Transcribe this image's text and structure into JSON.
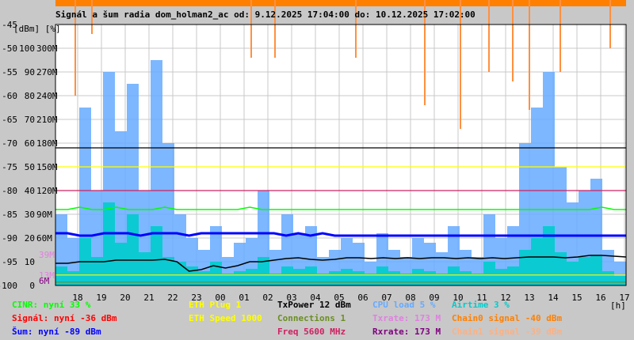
{
  "chart_data": {
    "type": "line",
    "title": "Signál a šum radia dom_holman2_ac od: 9.12.2025 17:04:00 do: 10.12.2025 17:02:00",
    "ylabel": "[dBm] [%]",
    "xlabel": "[h]",
    "ylim": [
      -100,
      -45
    ],
    "y_ticks": [
      {
        "dbm": "-45",
        "pct": "",
        "rate": ""
      },
      {
        "dbm": "-50",
        "pct": "100",
        "rate": "300M"
      },
      {
        "dbm": "-55",
        "pct": "90",
        "rate": "270M"
      },
      {
        "dbm": "-60",
        "pct": "80",
        "rate": "240M"
      },
      {
        "dbm": "-65",
        "pct": "70",
        "rate": "210M"
      },
      {
        "dbm": "-70",
        "pct": "60",
        "rate": "180M"
      },
      {
        "dbm": "-75",
        "pct": "50",
        "rate": "150M"
      },
      {
        "dbm": "-80",
        "pct": "40",
        "rate": "120M"
      },
      {
        "dbm": "-85",
        "pct": "30",
        "rate": "90M"
      },
      {
        "dbm": "-90",
        "pct": "20",
        "rate": "60M"
      },
      {
        "dbm": "-95",
        "pct": "10",
        "rate": ""
      },
      {
        "dbm": "-100",
        "pct": "0",
        "rate": ""
      }
    ],
    "x_ticks": [
      "18",
      "19",
      "20",
      "21",
      "22",
      "23",
      "00",
      "01",
      "02",
      "03",
      "04",
      "05",
      "06",
      "07",
      "08",
      "09",
      "10",
      "11",
      "12",
      "13",
      "14",
      "15",
      "16",
      "17"
    ],
    "rate_markers": [
      {
        "label": "39M",
        "value": 39,
        "color": "#e080e0"
      },
      {
        "label": "13M",
        "value": 13,
        "color": "#e080e0"
      },
      {
        "label": "6M",
        "value": 6,
        "color": "#800080"
      }
    ],
    "hlines": [
      {
        "name": "txpower",
        "dbm": -71,
        "color": "#000000"
      },
      {
        "name": "eth-speed",
        "dbm": -75,
        "color": "#ffff00"
      },
      {
        "name": "freq",
        "dbm": -80,
        "color": "#d02060"
      },
      {
        "name": "eth-plug",
        "dbm": -97.8,
        "color": "#ffff00"
      },
      {
        "name": "connections",
        "dbm": -99.3,
        "color": "#6b8e23"
      }
    ],
    "series": [
      {
        "name": "CPU load",
        "unit": "%",
        "color": "#66aaff",
        "values": [
          30,
          20,
          75,
          40,
          90,
          65,
          85,
          40,
          95,
          60,
          30,
          20,
          15,
          25,
          12,
          18,
          20,
          40,
          15,
          30,
          22,
          25,
          12,
          15,
          20,
          18,
          10,
          22,
          15,
          12,
          20,
          18,
          14,
          25,
          15,
          12,
          30,
          20,
          25,
          60,
          75,
          90,
          50,
          35,
          40,
          45,
          15,
          10
        ]
      },
      {
        "name": "Airtime",
        "unit": "%",
        "color": "#00cccc",
        "values": [
          8,
          6,
          20,
          12,
          35,
          18,
          30,
          14,
          25,
          12,
          10,
          8,
          6,
          10,
          5,
          6,
          7,
          12,
          5,
          8,
          7,
          8,
          5,
          6,
          7,
          6,
          5,
          8,
          6,
          5,
          7,
          6,
          5,
          8,
          6,
          5,
          10,
          7,
          8,
          15,
          20,
          25,
          14,
          10,
          12,
          13,
          6,
          4
        ]
      },
      {
        "name": "Šum",
        "unit": "dBm",
        "color": "#0000ff",
        "values": [
          -89,
          -89,
          -89.5,
          -89.5,
          -89,
          -89,
          -89,
          -89.5,
          -89,
          -89,
          -89,
          -89.5,
          -89,
          -89,
          -89,
          -89,
          -89,
          -89,
          -89,
          -89.5,
          -89,
          -89.5,
          -89,
          -89.5,
          -89.5,
          -89.5,
          -89.5,
          -89.5,
          -89.5,
          -89.5,
          -89.5,
          -89.5,
          -89.5,
          -89.5,
          -89.5,
          -89.5,
          -89.5,
          -89.5,
          -89.5,
          -89.5,
          -89.5,
          -89.5,
          -89.5,
          -89.5,
          -89.5,
          -89.5,
          -89.5,
          -89.5
        ]
      },
      {
        "name": "CINR",
        "unit": "%",
        "color": "#00ff00",
        "values": [
          32,
          32,
          33,
          32,
          32,
          33,
          32,
          32,
          32,
          33,
          32,
          32,
          32,
          32,
          32,
          32,
          33,
          32,
          32,
          32,
          32,
          32,
          32,
          32,
          32,
          32,
          32,
          32,
          32,
          32,
          32,
          32,
          32,
          32,
          32,
          32,
          32,
          32,
          32,
          32,
          32,
          32,
          32,
          32,
          32,
          33,
          32,
          32
        ]
      },
      {
        "name": "Rxrate",
        "unit": "M",
        "color": "#000000",
        "values": [
          28,
          28,
          30,
          30,
          30,
          32,
          32,
          32,
          32,
          33,
          30,
          18,
          20,
          25,
          22,
          25,
          30,
          30,
          32,
          34,
          35,
          33,
          32,
          33,
          35,
          35,
          34,
          35,
          34,
          35,
          34,
          35,
          35,
          34,
          35,
          34,
          35,
          34,
          35,
          36,
          36,
          36,
          35,
          36,
          38,
          38,
          37,
          36
        ]
      }
    ],
    "chain0_dips": [
      {
        "h": 0.9,
        "dbm": -60
      },
      {
        "h": 1.6,
        "dbm": -47
      },
      {
        "h": 8.3,
        "dbm": -52
      },
      {
        "h": 9.3,
        "dbm": -52
      },
      {
        "h": 12.7,
        "dbm": -52
      },
      {
        "h": 15.6,
        "dbm": -62
      },
      {
        "h": 17.1,
        "dbm": -67
      },
      {
        "h": 18.3,
        "dbm": -55
      },
      {
        "h": 19.3,
        "dbm": -57
      },
      {
        "h": 20.0,
        "dbm": -63
      },
      {
        "h": 21.3,
        "dbm": -55
      },
      {
        "h": 23.4,
        "dbm": -50
      }
    ]
  },
  "legend": [
    {
      "text": "CINR: nyní 33 %",
      "color": "#00ff00",
      "col": 0,
      "row": 0
    },
    {
      "text": "Signál: nyní -36 dBm",
      "color": "#ff0000",
      "col": 0,
      "row": 1
    },
    {
      "text": "Šum: nyní -89 dBm",
      "color": "#0000ff",
      "col": 0,
      "row": 2
    },
    {
      "text": "ETH Plug 1",
      "color": "#ffff00",
      "col": 1,
      "row": 0
    },
    {
      "text": "ETH Speed 1000",
      "color": "#ffff00",
      "col": 1,
      "row": 1
    },
    {
      "text": "TxPower 12 dBm",
      "color": "#000000",
      "col": 2,
      "row": 0
    },
    {
      "text": "Connections 1",
      "color": "#6b8e23",
      "col": 2,
      "row": 1
    },
    {
      "text": "Freq 5600 MHz",
      "color": "#d02060",
      "col": 2,
      "row": 2
    },
    {
      "text": "CPU load 5 %",
      "color": "#66aaff",
      "col": 3,
      "row": 0
    },
    {
      "text": "Txrate: 173 M",
      "color": "#e080e0",
      "col": 3,
      "row": 1
    },
    {
      "text": "Rxrate: 173 M",
      "color": "#800080",
      "col": 3,
      "row": 2
    },
    {
      "text": "Airtime 3 %",
      "color": "#00cccc",
      "col": 4,
      "row": 0
    },
    {
      "text": "Chain0 signal -40 dBm",
      "color": "#ff8000",
      "col": 4,
      "row": 1
    },
    {
      "text": "Chain1 signal -39 dBm",
      "color": "#ffb080",
      "col": 4,
      "row": 2
    }
  ]
}
